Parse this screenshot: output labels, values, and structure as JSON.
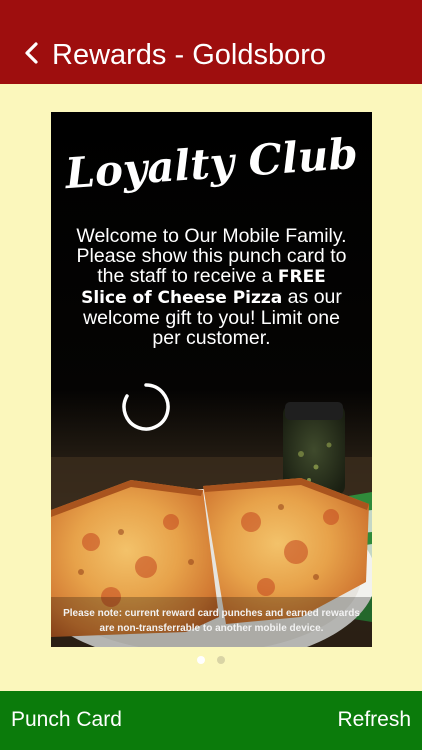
{
  "header": {
    "title": "Rewards - Goldsboro",
    "back_icon": "chevron-left-icon",
    "background_color": "#9E0E0E"
  },
  "card": {
    "title": "Loyalty Club",
    "message": {
      "part1": "Welcome to Our Mobile Family. Please show this punch card to the staff to receive a ",
      "highlight": "FREE Slice of Cheese Pizza",
      "part2": " as our welcome gift to you! Limit one per customer."
    },
    "note": "Please note: current reward card punches and earned rewards are non-transferrable to another mobile device.",
    "loading_icon": "loading-spinner-icon"
  },
  "pager": {
    "pages": 2,
    "active_index": 0
  },
  "footer": {
    "left_label": "Punch Card",
    "right_label": "Refresh",
    "background_color": "#0B7B0B"
  },
  "page_background": "#FBF7BC"
}
